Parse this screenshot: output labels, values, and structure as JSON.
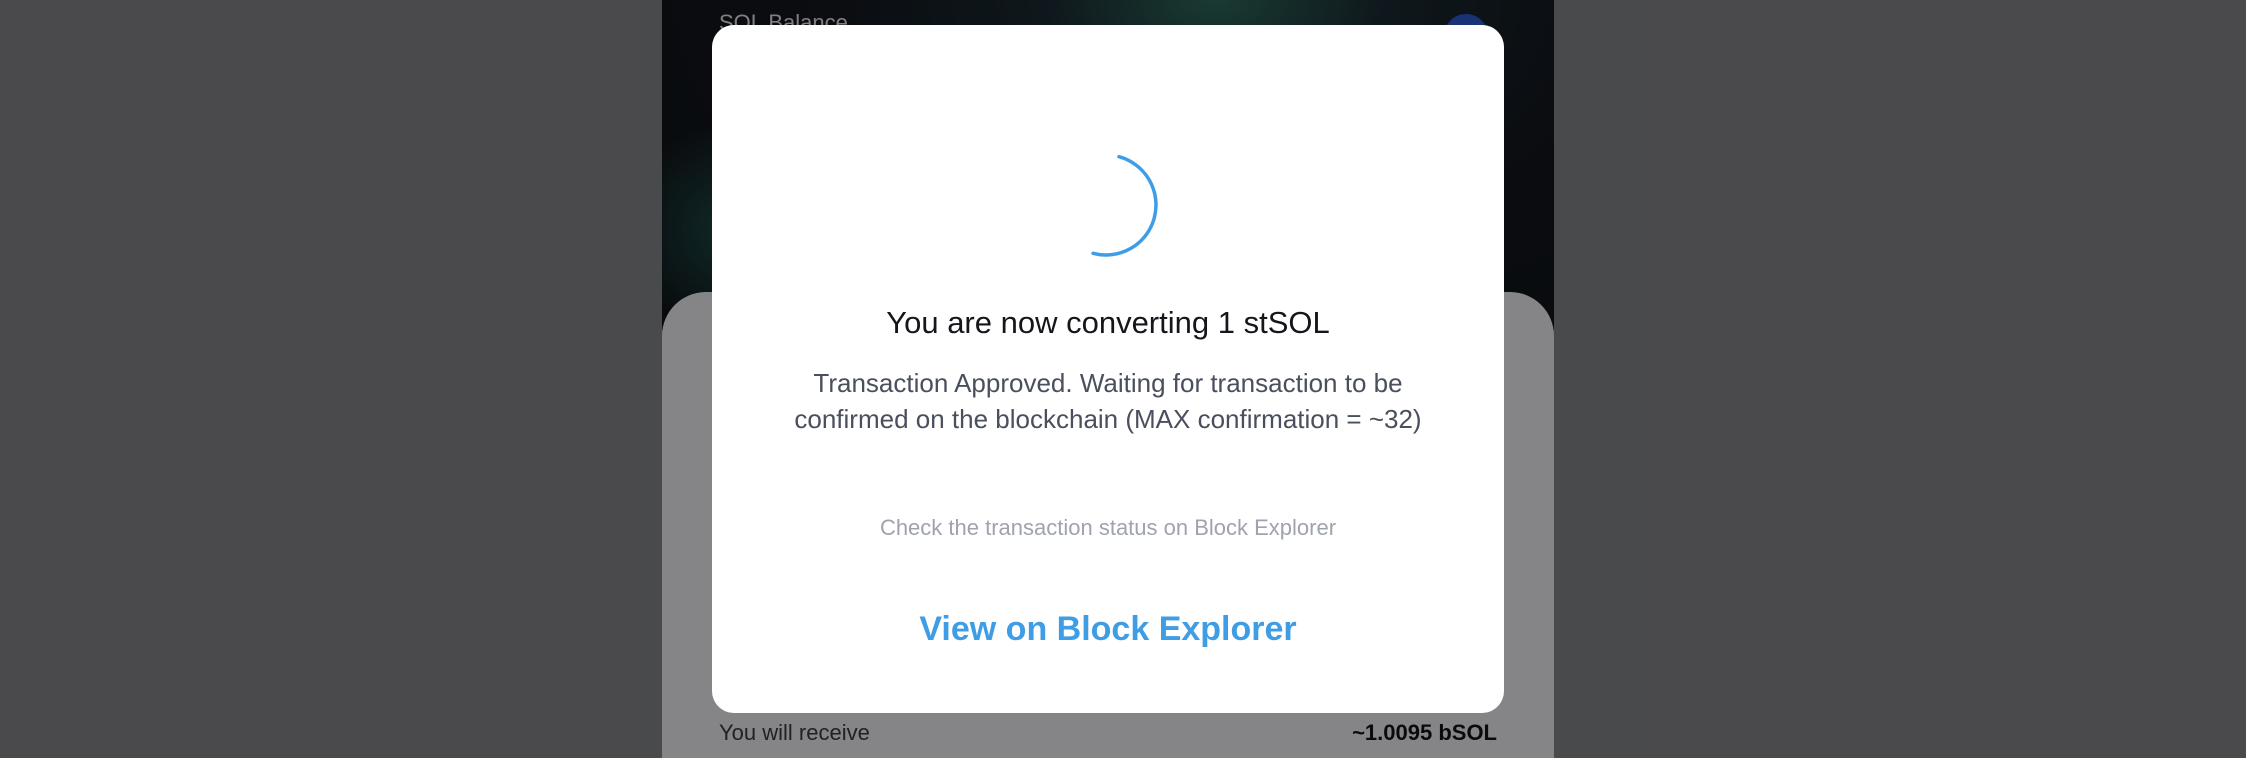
{
  "app": {
    "balance_label": "SOL Balance",
    "receive_label": "You will receive",
    "receive_value": "~1.0095 bSOL"
  },
  "modal": {
    "spinner_icon": "loading-spinner-icon",
    "title": "You are now converting 1 stSOL",
    "description": "Transaction Approved. Waiting for transaction to be confirmed on the blockchain (MAX confirmation = ~32)",
    "hint": "Check the transaction status on Block Explorer",
    "link_label": "View on Block Explorer"
  },
  "colors": {
    "accent": "#3f9de6",
    "overlay": "rgba(0,0,0,0.45)",
    "modal_bg": "#ffffff"
  }
}
